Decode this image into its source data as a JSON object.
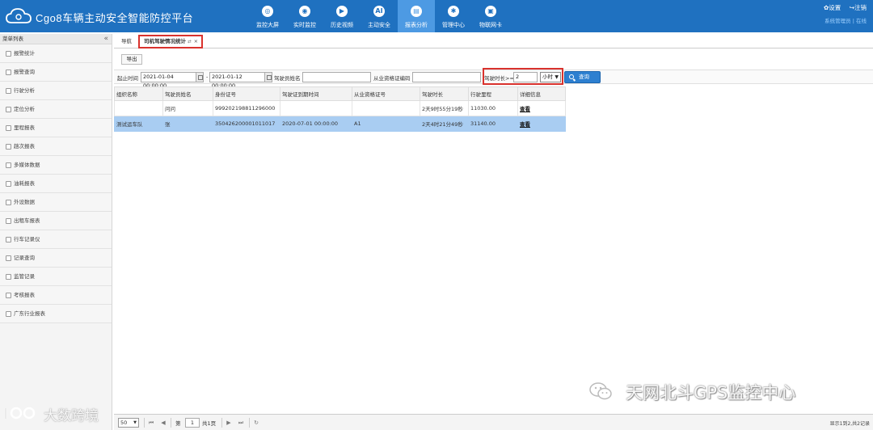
{
  "header": {
    "app_title": "Cgo8车辆主动安全智能防控平台",
    "nav": [
      {
        "label": "监控大屏",
        "icon": "monitor-screen-icon",
        "glyph": "◎"
      },
      {
        "label": "实时监控",
        "icon": "location-pin-icon",
        "glyph": "◉"
      },
      {
        "label": "历史视频",
        "icon": "play-video-icon",
        "glyph": "▶"
      },
      {
        "label": "主动安全",
        "icon": "ai-shield-icon",
        "glyph": "AI"
      },
      {
        "label": "报表分析",
        "icon": "report-chart-icon",
        "glyph": "▤"
      },
      {
        "label": "管理中心",
        "icon": "gear-icon",
        "glyph": "✱"
      },
      {
        "label": "物联网卡",
        "icon": "sim-card-icon",
        "glyph": "▣"
      }
    ],
    "settings_label": "✿设置",
    "logout_label": "↪注销",
    "user_label": "系统管理员 | 在线"
  },
  "sidebar": {
    "title": "菜单列表",
    "collapse_glyph": "«",
    "items": [
      {
        "label": "报警统计"
      },
      {
        "label": "报警查询"
      },
      {
        "label": "行驶分析"
      },
      {
        "label": "定位分析"
      },
      {
        "label": "里程报表"
      },
      {
        "label": "趟次报表"
      },
      {
        "label": "多媒体数据"
      },
      {
        "label": "油耗报表"
      },
      {
        "label": "外设数据"
      },
      {
        "label": "出租车报表"
      },
      {
        "label": "行车记录仪"
      },
      {
        "label": "记录查询"
      },
      {
        "label": "监管记录"
      },
      {
        "label": "考核报表"
      },
      {
        "label": "广东行业报表"
      }
    ]
  },
  "tabs": {
    "nav_label": "导航",
    "active_label": "司机驾驶情况统计",
    "refresh_glyph": "⇄",
    "close_glyph": "×"
  },
  "toolbar": {
    "export_label": "导出"
  },
  "filter": {
    "time_label": "起止时间",
    "start_time": "2021-01-04 00:00:00",
    "separator": "-",
    "end_time": "2021-01-12 00:00:00",
    "driver_name_label": "驾驶员姓名",
    "driver_name_value": "",
    "cert_label": "从业资格证编码",
    "cert_value": "",
    "duration_label": "驾驶时长>=",
    "duration_value": "2",
    "unit_value": "小时",
    "query_label": "查询"
  },
  "table": {
    "headers": [
      "组织名称",
      "驾驶员姓名",
      "身份证号",
      "驾驶证到期时间",
      "从业资格证号",
      "驾驶时长",
      "行驶里程",
      "详细信息"
    ],
    "rows": [
      [
        "",
        "问问",
        "999202198811296000",
        "",
        "",
        "2天9时55分19秒",
        "11030.00",
        "查看"
      ],
      [
        "测试运车队",
        "张",
        "350426200001011017",
        "2020-07-01 00:00:00",
        "A1",
        "2天4时21分49秒",
        "31140.00",
        "查看"
      ]
    ],
    "selected_row": 1
  },
  "pager": {
    "page_size": "50",
    "page_prefix": "第",
    "page_value": "1",
    "page_total": "共1页",
    "info": "显示1到2,共2记录"
  },
  "watermarks": {
    "left": "大数跨境",
    "right": "天网北斗GPS监控中心"
  },
  "colors": {
    "header_bg": "#1f71c0",
    "nav_active_bg": "#4d9ae3",
    "highlight_border": "#d9322d",
    "selected_row_bg": "#a9cdf2",
    "query_button_bg": "#2d7fd0"
  }
}
